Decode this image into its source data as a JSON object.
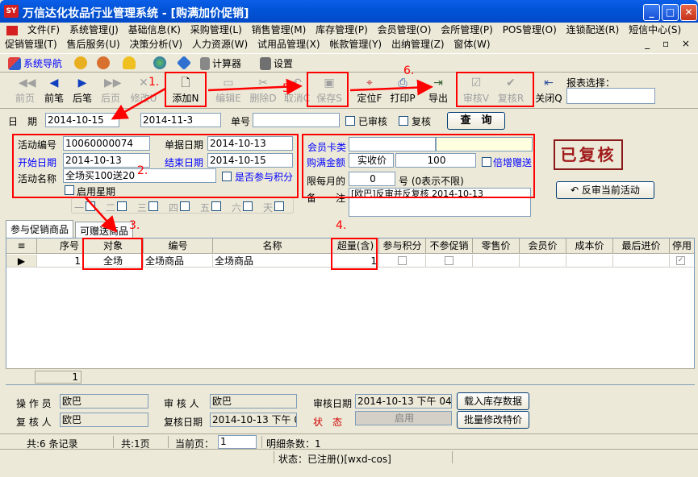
{
  "window": {
    "title": "万信达化妆品行业管理系统 - [购满加价促销]",
    "app_icon": "SY"
  },
  "menu1": [
    "文件(F)",
    "系统管理(J)",
    "基础信息(K)",
    "采购管理(L)",
    "销售管理(M)",
    "库存管理(P)",
    "会员管理(O)",
    "会所管理(P)",
    "POS管理(O)",
    "连锁配送(R)",
    "短信中心(S)"
  ],
  "menu2": [
    "促销管理(T)",
    "售后服务(U)",
    "决策分析(V)",
    "人力资源(W)",
    "试用品管理(X)",
    "帐款管理(Y)",
    "出纳管理(Z)",
    "窗体(W)"
  ],
  "navbar": {
    "system_nav": "系统导航",
    "calculator": "计算器",
    "settings": "设置"
  },
  "toolbar": {
    "first": "前页",
    "prev": "前笔",
    "next": "后笔",
    "last": "后页",
    "modify": "修改U",
    "add": "添加N",
    "edit": "编辑E",
    "delete": "删除D",
    "cancel": "取消C",
    "save": "保存S",
    "locate": "定位F",
    "print": "打印P",
    "export": "导出",
    "audit": "审核V",
    "review": "复核R",
    "close": "关闭Q",
    "report_label": "报表选择："
  },
  "filter": {
    "date_label": "日　期",
    "date_from": "2014-10-15",
    "date_to": "2014-11-3",
    "doc_no_label": "单号",
    "audited": "已审核",
    "reviewed": "复核",
    "query": "查　询"
  },
  "form": {
    "activity_no_label": "活动编号",
    "activity_no": "10060000074",
    "doc_date_label": "单据日期",
    "doc_date": "2014-10-13",
    "start_date_label": "开始日期",
    "start_date": "2014-10-13",
    "end_date_label": "结束日期",
    "end_date": "2014-10-15",
    "activity_name_label": "活动名称",
    "activity_name": "全场买100送20",
    "join_points": "是否参与积分",
    "enable_weekday": "启用星期",
    "weekdays": [
      "一",
      "二",
      "三",
      "四",
      "五",
      "六",
      "天"
    ],
    "member_card_label": "会员卡类",
    "member_card": "",
    "purchase_amount_label": "购满金额",
    "price_type": "实收价",
    "purchase_amount": "100",
    "multiply_gift": "倍增赠送",
    "limit_label": "限每月的",
    "limit_value": "0",
    "limit_hint": "号 (0表示不限)",
    "remark_label": "备　　注",
    "remark": "[欧巴]反审并反复核 2014-10-13",
    "stamp": "已复核",
    "reverse_audit": "反审当前活动"
  },
  "tabs": [
    "参与促销商品",
    "可赠送商品"
  ],
  "grid": {
    "headers": [
      "序号",
      "对象",
      "编号",
      "名称",
      "超量(含)",
      "参与积分",
      "不参促销",
      "零售价",
      "会员价",
      "成本价",
      "最后进价",
      "停用"
    ],
    "rows": [
      {
        "seq": "1",
        "target": "全场",
        "code": "全场商品",
        "name": "全场商品",
        "qty": "1"
      }
    ],
    "footer_count": "1"
  },
  "bottom": {
    "operator_label": "操 作 员",
    "operator": "欧巴",
    "auditor_label": "审 核 人",
    "auditor": "欧巴",
    "audit_date_label": "审核日期",
    "audit_date": "2014-10-13 下午 04:4",
    "load_stock": "载入库存数据",
    "reviewer_label": "复 核 人",
    "reviewer": "欧巴",
    "review_date_label": "复核日期",
    "review_date": "2014-10-13 下午 0",
    "status_label": "状　态",
    "status_value": "启用",
    "batch_modify": "批量修改特价"
  },
  "status": {
    "records": "共:6 条记录",
    "pages": "共:1页",
    "current_page_label": "当前页：",
    "current_page": "1",
    "detail_count": "明细条数：1",
    "reg_status": "状态：已注册()[wxd-cos]"
  },
  "annotations": [
    "1.",
    "2.",
    "3.",
    "4.",
    "5",
    "6."
  ],
  "colors": {
    "titlebar": "#0054e3",
    "annotation": "#ff0000",
    "blue_label": "#0000ff"
  }
}
